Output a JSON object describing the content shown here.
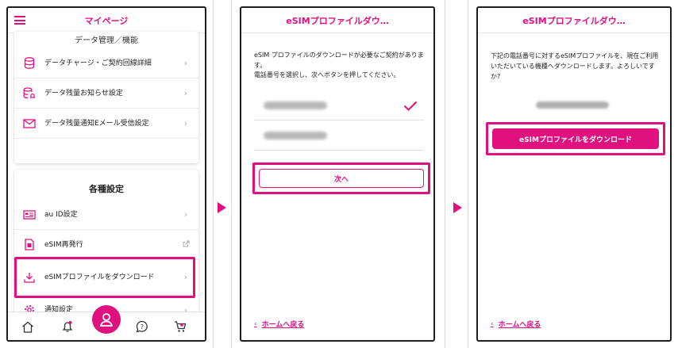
{
  "colors": {
    "accent": "#e0117f",
    "frame": "#1e1e1e"
  },
  "screen1": {
    "title": "マイページ",
    "partial_heading": "データ管理／機能",
    "data_items": [
      {
        "label": "データチャージ・ご契約回線詳細",
        "icon": "database-icon"
      },
      {
        "label": "データ残量お知らせ設定",
        "icon": "database-bell-icon"
      },
      {
        "label": "データ残量通知Eメール受信設定",
        "icon": "mail-icon"
      }
    ],
    "settings_title": "各種設定",
    "settings_items": [
      {
        "label": "au ID設定",
        "icon": "id-card-icon"
      },
      {
        "label": "eSIM再発行",
        "icon": "sim-card-icon"
      },
      {
        "label": "eSIMプロファイルをダウンロード",
        "icon": "download-icon"
      },
      {
        "label": "通知設定",
        "icon": "gear-icon"
      }
    ],
    "tabs": [
      "home-icon",
      "bell-icon",
      "person-icon",
      "chat-question-icon",
      "cart-icon"
    ]
  },
  "screen2": {
    "title": "eSIMプロファイルダウ…",
    "intro": "eSIM プロファイルのダウンロードが必要なご契約があります。",
    "instruction": "電話番号を選択し、次へボタンを押してください。",
    "next_label": "次へ",
    "back_label": "ホームへ戻る"
  },
  "screen3": {
    "title": "eSIMプロファイルダウ…",
    "intro": "下記の電話番号に対するeSIMプロファイルを、現在ご利用いただいている機種へダウンロードします。よろしいですか?",
    "download_label": "eSIMプロファイルをダウンロード",
    "back_label": "ホームへ戻る"
  }
}
